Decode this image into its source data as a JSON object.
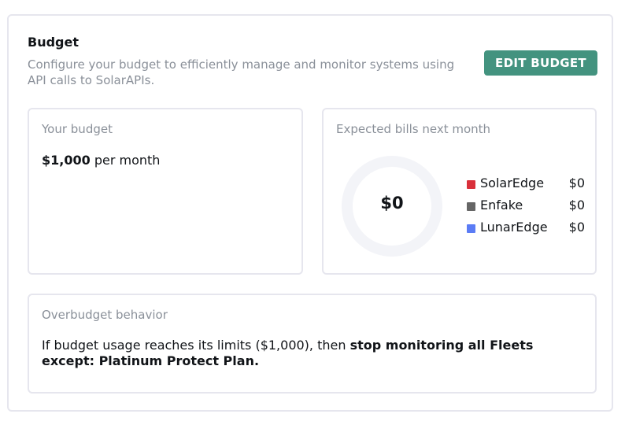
{
  "budget": {
    "title": "Budget",
    "description": "Configure your budget to efficiently manage and monitor systems using API calls to SolarAPIs.",
    "edit_label": "EDIT BUDGET"
  },
  "your_budget": {
    "label": "Your budget",
    "amount": "$1,000",
    "period": " per month"
  },
  "bills": {
    "label": "Expected bills next month",
    "total": "$0",
    "items": [
      {
        "name": "SolarEdge",
        "value": "$0",
        "color": "#d9303a"
      },
      {
        "name": "Enfake",
        "value": "$0",
        "color": "#666666"
      },
      {
        "name": "LunarEdge",
        "value": "$0",
        "color": "#5b7cf5"
      }
    ]
  },
  "overbudget": {
    "label": "Overbudget behavior",
    "text_prefix": "If budget usage reaches its limits ($1,000), then ",
    "text_strong": "stop monitoring all Fleets except: Platinum Protect Plan."
  },
  "colors": {
    "accent": "#43937f",
    "muted_text": "#8a9099",
    "border": "#e6e6ee",
    "donut_track": "#f3f4f8"
  }
}
